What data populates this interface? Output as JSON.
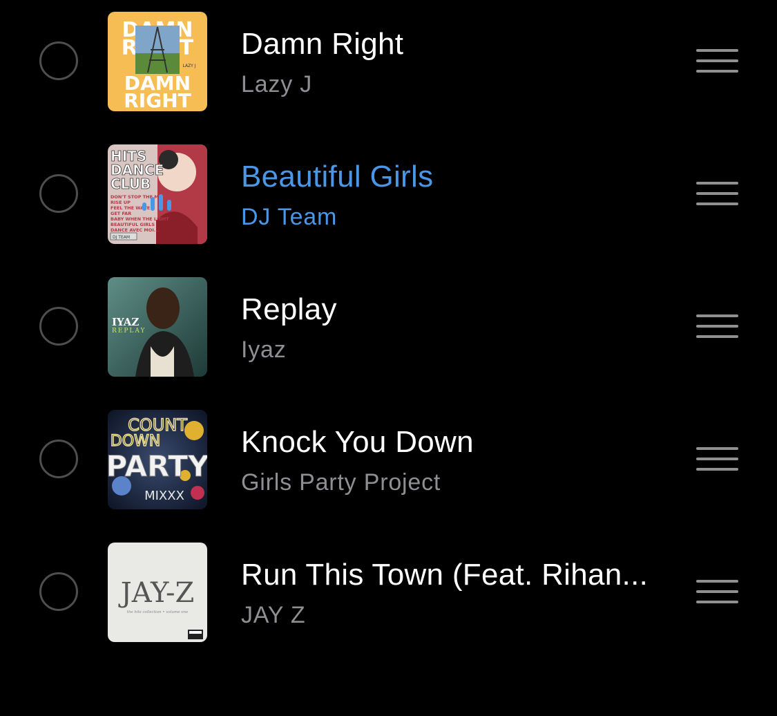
{
  "songs": [
    {
      "title": "Damn Right",
      "artist": "Lazy J",
      "cover_text": [
        "DAMN",
        "RIGHT",
        "DAMN",
        "RIGHT",
        "LAZY J"
      ],
      "cover_bg": "#f5bd54"
    },
    {
      "title": "Beautiful Girls",
      "artist": "DJ Team",
      "playing": true,
      "cover_text": [
        "HITS",
        "DANCE",
        "CLUB",
        "DON'T STOP THE MUSIC",
        "RISE UP",
        "FEEL THE WAVE",
        "GET FAR",
        "BABY WHEN THE LIGHT",
        "BEAUTIFUL GIRLS",
        "DANCE AVEC MOI...",
        "DJ TEAM"
      ]
    },
    {
      "title": "Replay",
      "artist": "Iyaz",
      "cover_text": [
        "IYAZ",
        "REPLAY"
      ]
    },
    {
      "title": "Knock You Down",
      "artist": "Girls Party Project",
      "cover_text": [
        "COUNT",
        "DOWN",
        "PARTY",
        "MIXXX"
      ]
    },
    {
      "title": "Run This Town (Feat. Rihan...",
      "artist": "JAY Z",
      "cover_text": [
        "JAY-Z",
        "the hits collection • volume one"
      ]
    }
  ],
  "accent_color": "#4a97e8",
  "icons": {
    "select": "circle-icon",
    "reorder": "drag-handle-icon",
    "now_playing": "equalizer-icon"
  }
}
